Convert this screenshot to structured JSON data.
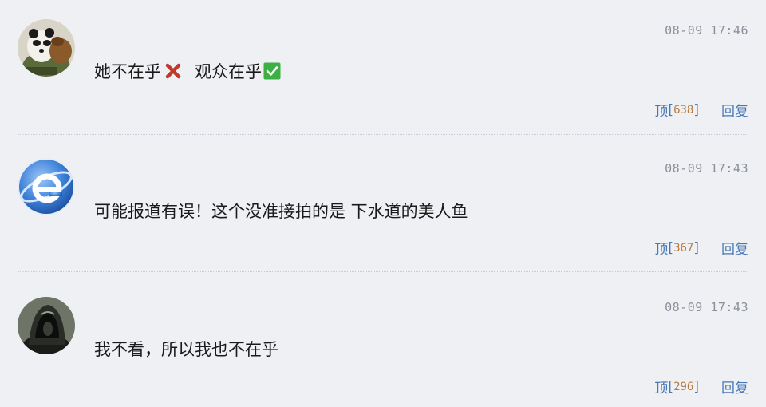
{
  "comments": [
    {
      "avatar": "panda-avatar",
      "time": "08-09 17:46",
      "text_part1": "她不在乎",
      "text_part2": "观众在乎",
      "like_label": "顶",
      "like_count": "638",
      "reply_label": "回复"
    },
    {
      "avatar": "ie-browser-avatar",
      "time": "08-09 17:43",
      "text": "可能报道有误！这个没准接拍的是 下水道的美人鱼",
      "like_label": "顶",
      "like_count": "367",
      "reply_label": "回复"
    },
    {
      "avatar": "hooded-figure-avatar",
      "time": "08-09 17:43",
      "text": "我不看，所以我也不在乎",
      "like_label": "顶",
      "like_count": "296",
      "reply_label": "回复"
    }
  ],
  "icons": {
    "cross": "cross-mark-icon",
    "check": "check-mark-icon"
  },
  "colors": {
    "background": "#eef0f4",
    "link": "#4a78b4",
    "count": "#b87a3f",
    "time": "#8a8f99",
    "cross": "#c0392b",
    "check": "#3cb043"
  }
}
